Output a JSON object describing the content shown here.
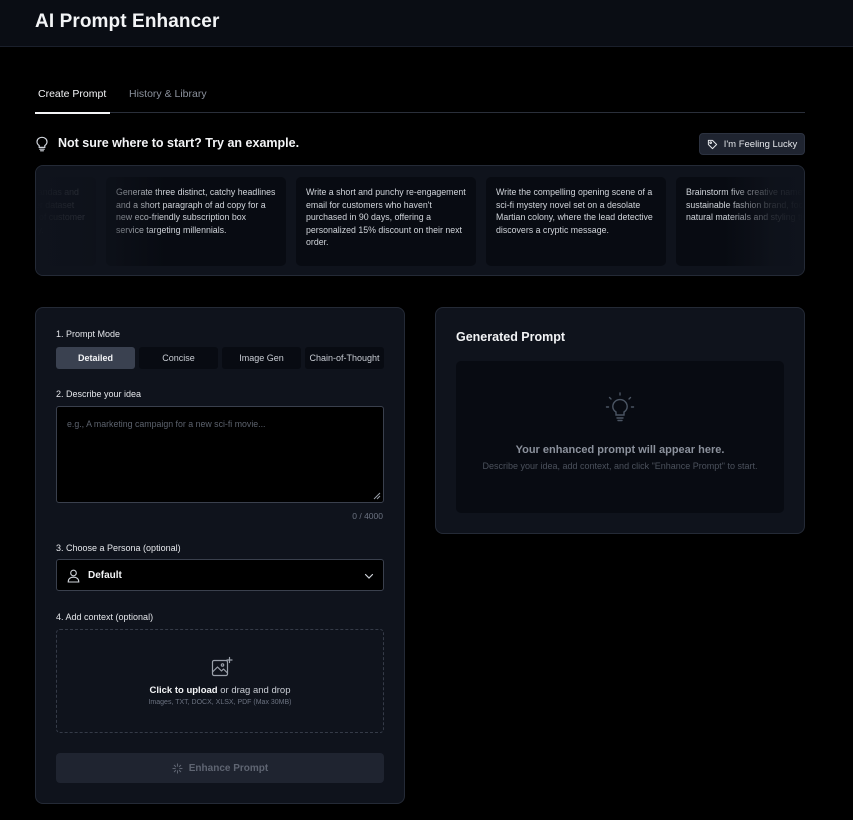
{
  "header": {
    "title": "AI Prompt Enhancer"
  },
  "tabs": [
    {
      "label": "Create Prompt",
      "active": true
    },
    {
      "label": "History & Library",
      "active": false
    }
  ],
  "examples": {
    "heading": "Not sure where to start? Try an example.",
    "lucky_label": "I'm Feeling Lucky",
    "cards": [
      {
        "text": "Write a Python script using pandas and matplotlib to clean a customer dataset and visualize the distribution of customer ages and purchase frequency."
      },
      {
        "text": "Generate three distinct, catchy headlines and a short paragraph of ad copy for a new eco-friendly subscription box service targeting millennials."
      },
      {
        "text": "Write a short and punchy re-engagement email for customers who haven't purchased in 90 days, offering a personalized 15% discount on their next order."
      },
      {
        "text": "Write the compelling opening scene of a sci-fi mystery novel set on a desolate Martian colony, where the lead detective discovers a cryptic message."
      },
      {
        "text": "Brainstorm five creative names for a sustainable fashion brand, focusing on natural materials and styling tips."
      }
    ]
  },
  "form": {
    "mode_label": "1. Prompt Mode",
    "modes": [
      {
        "label": "Detailed",
        "selected": true
      },
      {
        "label": "Concise",
        "selected": false
      },
      {
        "label": "Image Gen",
        "selected": false
      },
      {
        "label": "Chain-of-Thought",
        "selected": false
      }
    ],
    "idea_label": "2. Describe your idea",
    "idea_placeholder": "e.g., A marketing campaign for a new sci-fi movie...",
    "idea_value": "",
    "counter": "0 / 4000",
    "persona_label": "3. Choose a Persona (optional)",
    "persona_value": "Default",
    "context_label": "4. Add context (optional)",
    "upload_strong": "Click to upload",
    "upload_rest": " or drag and drop",
    "upload_types": "Images, TXT, DOCX, XLSX, PDF (Max 30MB)",
    "enhance_label": "Enhance Prompt"
  },
  "output": {
    "title": "Generated Prompt",
    "placeholder_title": "Your enhanced prompt will appear here.",
    "placeholder_sub": "Describe your idea, add context, and click \"Enhance Prompt\" to start."
  },
  "colors": {
    "background": "#000000",
    "panel": "#0f131c",
    "border": "#242a36",
    "selected_mode": "#3a4150",
    "text": "#f3f4f6"
  }
}
